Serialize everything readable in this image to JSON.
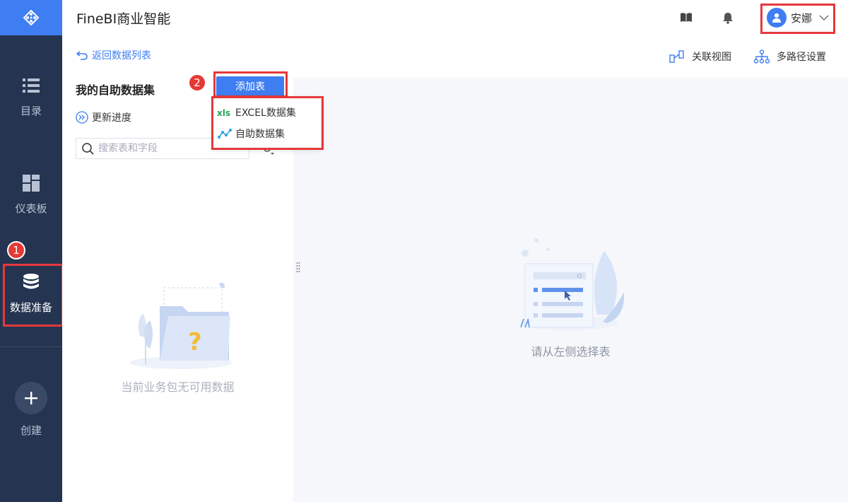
{
  "app": {
    "title": "FineBI商业智能"
  },
  "sidebar": {
    "items": [
      {
        "label": "目录",
        "icon": "list-icon"
      },
      {
        "label": "仪表板",
        "icon": "dashboard-icon"
      },
      {
        "label": "数据准备",
        "icon": "database-icon",
        "active": true
      },
      {
        "label": "创建",
        "icon": "plus-icon"
      }
    ]
  },
  "header": {
    "user_name": "安娜",
    "icons": [
      "book-icon",
      "bell-icon",
      "user-avatar-icon",
      "chevron-down-icon"
    ]
  },
  "left_panel": {
    "back_label": "返回数据列表",
    "title": "我的自助数据集",
    "add_button": "添加表",
    "update_label": "更新进度",
    "search_placeholder": "搜索表和字段",
    "empty_text": "当前业务包无可用数据"
  },
  "dropdown": {
    "items": [
      {
        "label": "EXCEL数据集",
        "icon": "xls-icon"
      },
      {
        "label": "自助数据集",
        "icon": "self-service-icon"
      }
    ]
  },
  "toolbar": {
    "relation_view": "关联视图",
    "multi_path": "多路径设置"
  },
  "main": {
    "empty_text": "请从左侧选择表"
  },
  "annotations": {
    "badge1": "1",
    "badge2": "2"
  },
  "colors": {
    "accent": "#3e7df2",
    "sidebar": "#253450",
    "highlight": "#e5383b",
    "excel_green": "#1fa65a"
  }
}
